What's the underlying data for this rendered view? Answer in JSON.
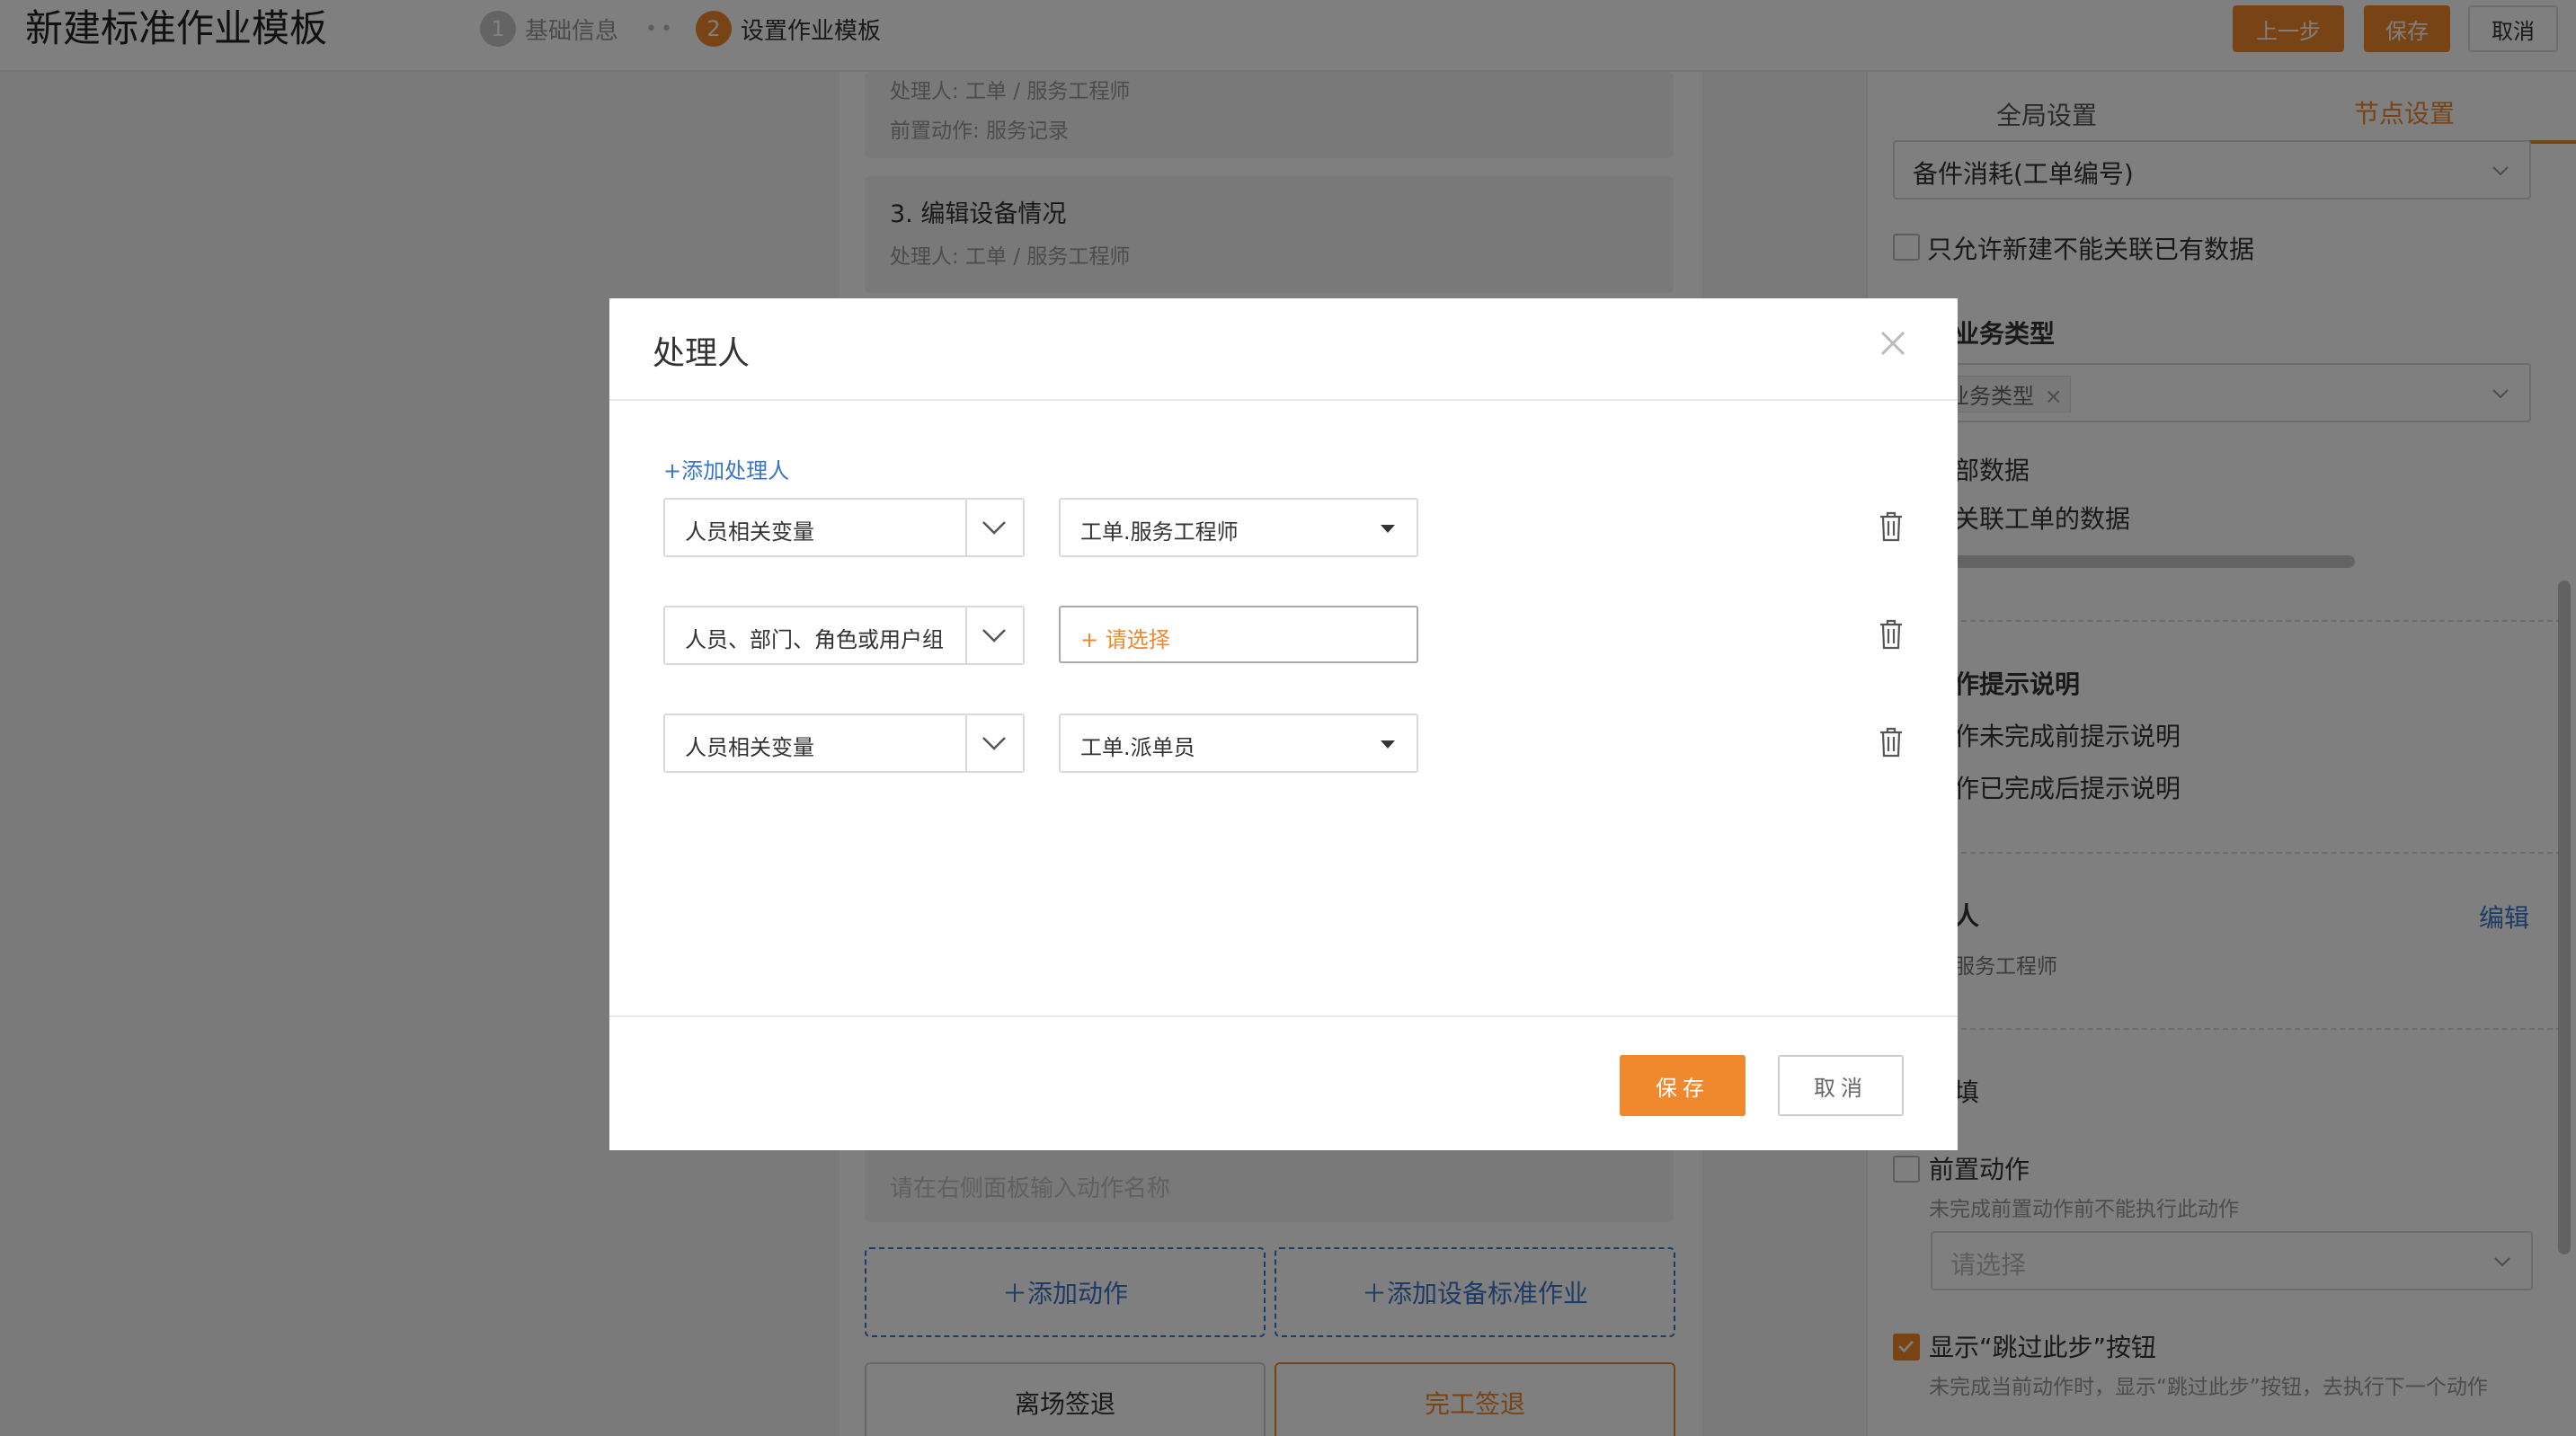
{
  "header": {
    "title": "新建标准作业模板",
    "steps": [
      {
        "num": "1",
        "label": "基础信息"
      },
      {
        "num": "2",
        "label": "设置作业模板"
      }
    ],
    "step_dots": "••",
    "buttons": {
      "prev": "上一步",
      "save": "保存",
      "cancel": "取消"
    }
  },
  "center": {
    "card1": {
      "handler": "处理人:  工单 / 服务工程师",
      "pre_action": "前置动作:  服务记录"
    },
    "card2": {
      "title": "3. 编辑设备情况",
      "handler": "处理人:  工单 / 服务工程师"
    },
    "new_action_placeholder": "请在右侧面板输入动作名称",
    "add_action": "＋添加动作",
    "add_standard": "＋添加设备标准作业",
    "leave_checkout": "离场签退",
    "finish_checkout": "完工签退"
  },
  "right_panel": {
    "tabs": {
      "global": "全局设置",
      "node": "节点设置"
    },
    "parts_select": "备件消耗(工单编号)",
    "only_new_label": "只允许新建不能关联已有数据",
    "biz_type_heading": "业务类型",
    "biz_type_tag": "业务类型",
    "all_data": "部数据",
    "linked_data": "关联工单的数据",
    "tips_heading": "作提示说明",
    "tip_before": "作未完成前提示说明",
    "tip_after": "作已完成后提示说明",
    "handler_heading": "人",
    "handler_edit": "编辑",
    "handler_value": "服务工程师",
    "required_label": "填",
    "pre_action_label": "前置动作",
    "pre_action_sub": "未完成前置动作前不能执行此动作",
    "pre_action_placeholder": "请选择",
    "skip_label": "显示“跳过此步”按钮",
    "skip_sub": "未完成当前动作时，显示“跳过此步”按钮，去执行下一个动作"
  },
  "modal": {
    "title": "处理人",
    "add_handler": "+添加处理人",
    "rows": [
      {
        "type": "人员相关变量",
        "value": "工单.服务工程师",
        "is_placeholder": false
      },
      {
        "type": "人员、部门、角色或用户组",
        "value": "+ 请选择",
        "is_placeholder": true
      },
      {
        "type": "人员相关变量",
        "value": "工单.派单员",
        "is_placeholder": false
      }
    ],
    "save": "保存",
    "cancel": "取消"
  },
  "colors": {
    "accent": "#f0882d",
    "link": "#3a76c8"
  }
}
